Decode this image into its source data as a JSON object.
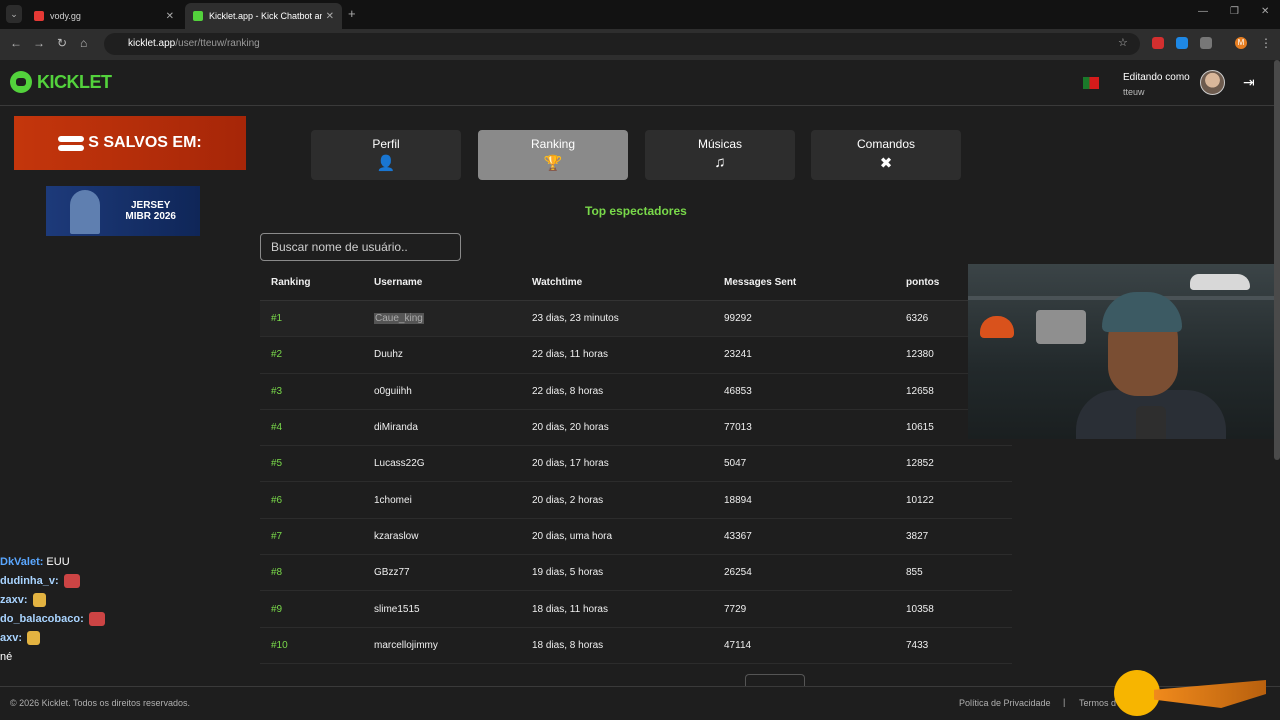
{
  "browser": {
    "tabs": [
      {
        "title": "vody.gg",
        "favicon_color": "#e53935"
      },
      {
        "title": "Kicklet.app - Kick Chatbot and …",
        "favicon_color": "#53d23c"
      }
    ],
    "url_host": "kicklet.app",
    "url_path": "/user/tteuw/ranking",
    "profile_initial": "M"
  },
  "site": {
    "logo": "KICKLET",
    "editing_label": "Editando como",
    "username": "tteuw"
  },
  "ads": {
    "ad1_text": "S SALVOS EM:",
    "ad2_line1": "JERSEY",
    "ad2_line2": "MIBR 2026"
  },
  "tabs": [
    {
      "label": "Perfil",
      "icon": "person-icon",
      "glyph": "👤"
    },
    {
      "label": "Ranking",
      "icon": "trophy-icon",
      "glyph": "🏆"
    },
    {
      "label": "Músicas",
      "icon": "music-list-icon",
      "glyph": "♫"
    },
    {
      "label": "Comandos",
      "icon": "tools-icon",
      "glyph": "✖"
    }
  ],
  "section_title": "Top espectadores",
  "search": {
    "placeholder": "Buscar nome de usuário.."
  },
  "table": {
    "headers": [
      "Ranking",
      "Username",
      "Watchtime",
      "Messages Sent",
      "pontos"
    ],
    "rows": [
      [
        "#1",
        "Caue_king",
        "23 dias, 23 minutos",
        "99292",
        "6326"
      ],
      [
        "#2",
        "Duuhz",
        "22 dias, 11 horas",
        "23241",
        "12380"
      ],
      [
        "#3",
        "o0guiihh",
        "22 dias, 8 horas",
        "46853",
        "12658"
      ],
      [
        "#4",
        "diMiranda",
        "20 dias, 20 horas",
        "77013",
        "10615"
      ],
      [
        "#5",
        "Lucass22G",
        "20 dias, 17 horas",
        "5047",
        "12852"
      ],
      [
        "#6",
        "1chomei",
        "20 dias, 2 horas",
        "18894",
        "10122"
      ],
      [
        "#7",
        "kzaraslow",
        "20 dias, uma hora",
        "43367",
        "3827"
      ],
      [
        "#8",
        "GBzz77",
        "19 dias, 5 horas",
        "26254",
        "855"
      ],
      [
        "#9",
        "slime1515",
        "18 dias, 11 horas",
        "7729",
        "10358"
      ],
      [
        "#10",
        "marcellojimmy",
        "18 dias, 8 horas",
        "47114",
        "7433"
      ]
    ]
  },
  "chat": [
    {
      "nick": "DkValet:",
      "msg": "EUU"
    },
    {
      "nick": "dudinha_v:",
      "msg": ""
    },
    {
      "nick": "zaxv:",
      "msg": ""
    },
    {
      "nick": "do_balacobaco:",
      "msg": ""
    },
    {
      "nick": "axv:",
      "msg": ""
    },
    {
      "nick": "",
      "msg": "né"
    }
  ],
  "footer": {
    "copyright": "© 2026 Kicklet. Todos os direitos reservados.",
    "privacy": "Política de Privacidade",
    "separator": "|",
    "terms": "Termos d"
  },
  "colors": {
    "accent": "#79d94a",
    "brand": "#53d23c",
    "active_tab": "#8a8a8a"
  }
}
